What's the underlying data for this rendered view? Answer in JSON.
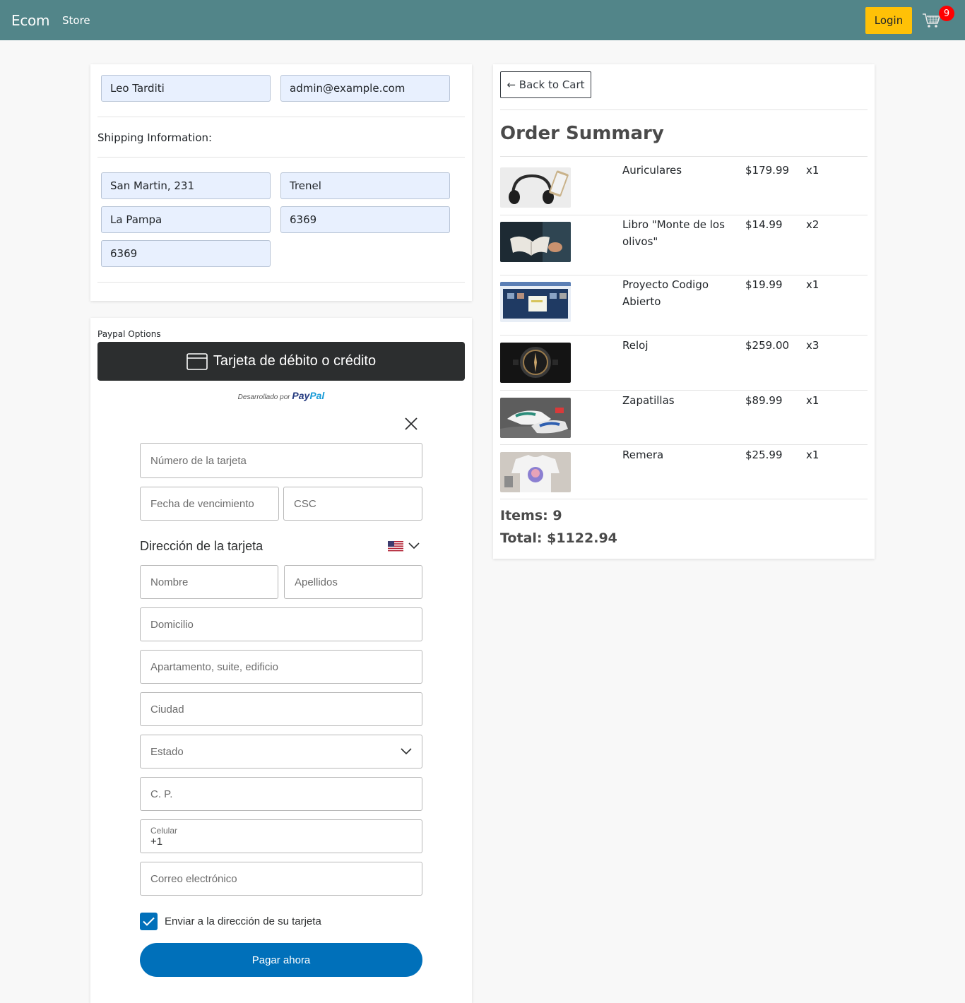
{
  "navbar": {
    "brand": "Ecom",
    "store_label": "Store",
    "login_label": "Login",
    "cart_count": "9",
    "cart_icon": "cart-icon"
  },
  "user": {
    "name": "Leo Tarditi",
    "email": "admin@example.com"
  },
  "shipping": {
    "label": "Shipping Information:",
    "address": "San Martin, 231",
    "city": "Trenel",
    "state": "La Pampa",
    "zipcode": "6369",
    "country": "6369"
  },
  "paypal": {
    "options_label": "Paypal Options",
    "card_button_label": "Tarjeta de débito o crédito",
    "powered_prefix": "Desarrollado por",
    "brand_pay": "Pay",
    "brand_pal": "Pal",
    "card_number_placeholder": "Número de la tarjeta",
    "expiry_placeholder": "Fecha de vencimiento",
    "csc_placeholder": "CSC",
    "billing_title": "Dirección de la tarjeta",
    "first_name_placeholder": "Nombre",
    "last_name_placeholder": "Apellidos",
    "address_placeholder": "Domicilio",
    "apt_placeholder": "Apartamento, suite, edificio",
    "city_placeholder": "Ciudad",
    "state_placeholder": "Estado",
    "zip_placeholder": "C. P.",
    "phone_label": "Celular",
    "phone_value": "+1",
    "email_placeholder": "Correo electrónico",
    "ship_to_card_label": "Enviar a la dirección de su tarjeta",
    "pay_now_label": "Pagar ahora",
    "ship_to_card_checked": true
  },
  "summary": {
    "back_label": "← Back to Cart",
    "title": "Order Summary",
    "items": [
      {
        "name": "Auriculares",
        "price": "$179.99",
        "qty": "x1"
      },
      {
        "name": "Libro \"Monte de los olivos\"",
        "price": "$14.99",
        "qty": "x2"
      },
      {
        "name": "Proyecto Codigo Abierto",
        "price": "$19.99",
        "qty": "x1"
      },
      {
        "name": "Reloj",
        "price": "$259.00",
        "qty": "x3"
      },
      {
        "name": "Zapatillas",
        "price": "$89.99",
        "qty": "x1"
      },
      {
        "name": "Remera",
        "price": "$25.99",
        "qty": "x1"
      }
    ],
    "items_label": "Items: 9",
    "total_label": "Total: $1122.94"
  },
  "colors": {
    "navbar": "#528589",
    "login": "#ffc107",
    "badge": "#ff0000",
    "paypal_blue": "#0070ba",
    "paypal_dark": "#2c2e2f"
  }
}
